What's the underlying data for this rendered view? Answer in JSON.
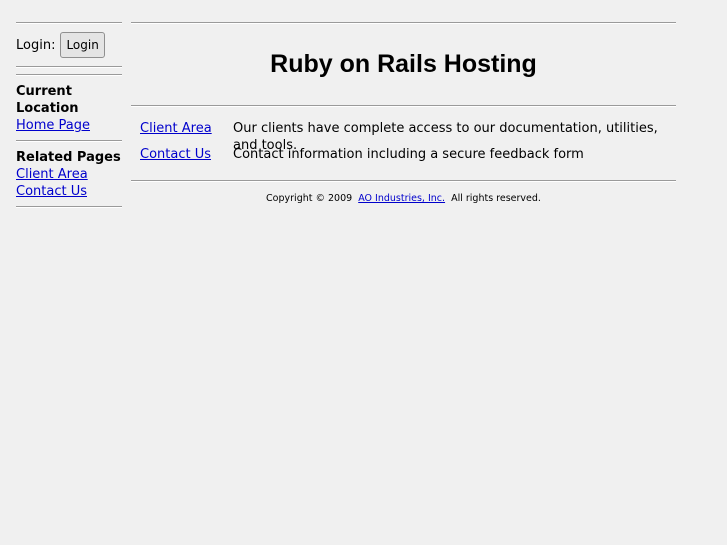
{
  "sidebar": {
    "login_label": "Login:",
    "login_button": "Login",
    "current_location": {
      "title": "Current Location",
      "items": [
        "Home Page"
      ]
    },
    "related_pages": {
      "title": "Related Pages",
      "items": [
        "Client Area",
        "Contact Us"
      ]
    }
  },
  "main": {
    "title": "Ruby on Rails Hosting",
    "links": [
      {
        "label": "Client Area",
        "description": "Our clients have complete access to our documentation, utilities, and tools."
      },
      {
        "label": "Contact Us",
        "description": "Contact information including a secure feedback form"
      }
    ]
  },
  "footer": {
    "copyright": "Copyright © 2009",
    "company": "AO Industries, Inc.",
    "rights": "All rights reserved."
  },
  "colors": {
    "link": "#0000cc",
    "background": "#f0f0f0",
    "rule": "#9a9a9a"
  }
}
